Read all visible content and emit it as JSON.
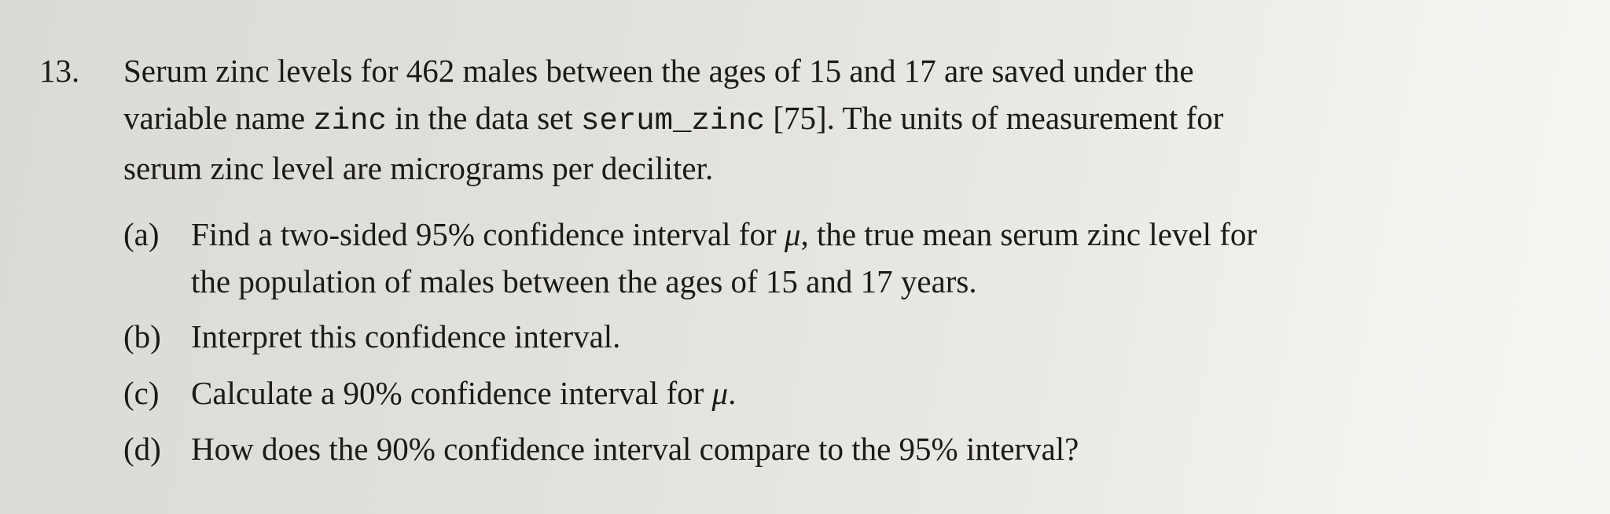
{
  "problem": {
    "number": "13.",
    "stem_lines": [
      {
        "before": "Serum zinc levels for 462 males between the ages of 15 and 17 are saved under the"
      },
      {
        "before": "variable name ",
        "code1": "zinc",
        "middle": " in the data set ",
        "code2": "serum_zinc",
        "after": " [75]. The units of measurement for"
      },
      {
        "before": "serum zinc level are micrograms per deciliter."
      }
    ],
    "parts": [
      {
        "label": "(a)",
        "line1_before": "Find a two-sided 95% confidence interval for ",
        "line1_mu": "μ",
        "line1_after": ", the true mean serum zinc level for",
        "line2": "the population of males between the ages of 15 and 17 years."
      },
      {
        "label": "(b)",
        "text": "Interpret this confidence interval."
      },
      {
        "label": "(c)",
        "text_before": "Calculate a 90% confidence interval for ",
        "mu": "μ",
        "text_after": "."
      },
      {
        "label": "(d)",
        "text": "How does the 90% confidence interval compare to the 95% interval?"
      }
    ]
  }
}
